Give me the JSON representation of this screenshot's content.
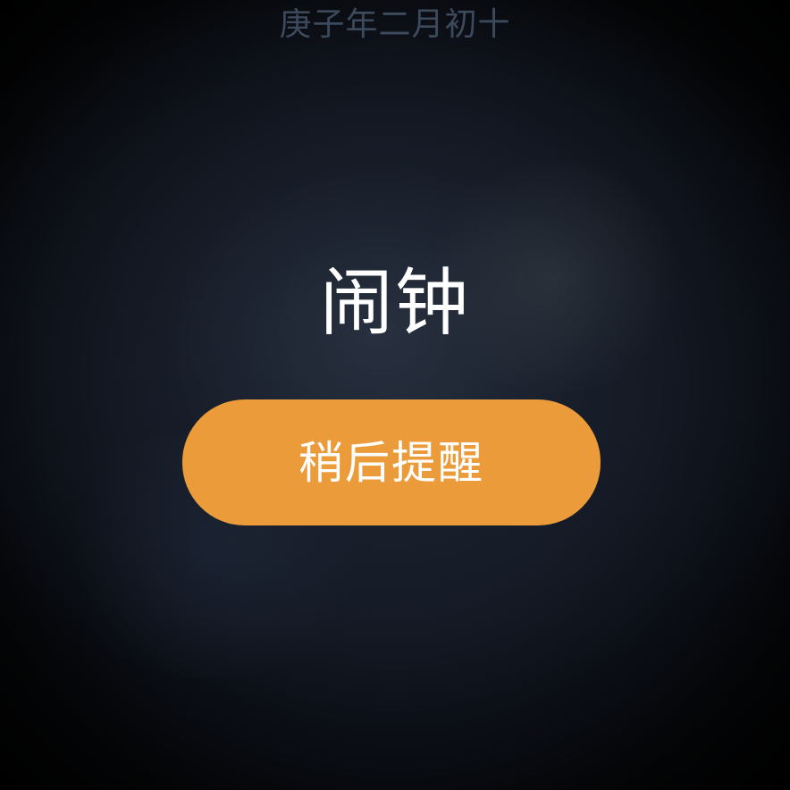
{
  "status": {
    "lunar_date": "庚子年二月初十"
  },
  "alarm": {
    "title": "闹钟",
    "snooze_label": "稍后提醒"
  },
  "colors": {
    "accent": "#ec9b3b",
    "background": "#141a25",
    "title_text": "#ffffff",
    "date_text": "#3c4a5c"
  }
}
